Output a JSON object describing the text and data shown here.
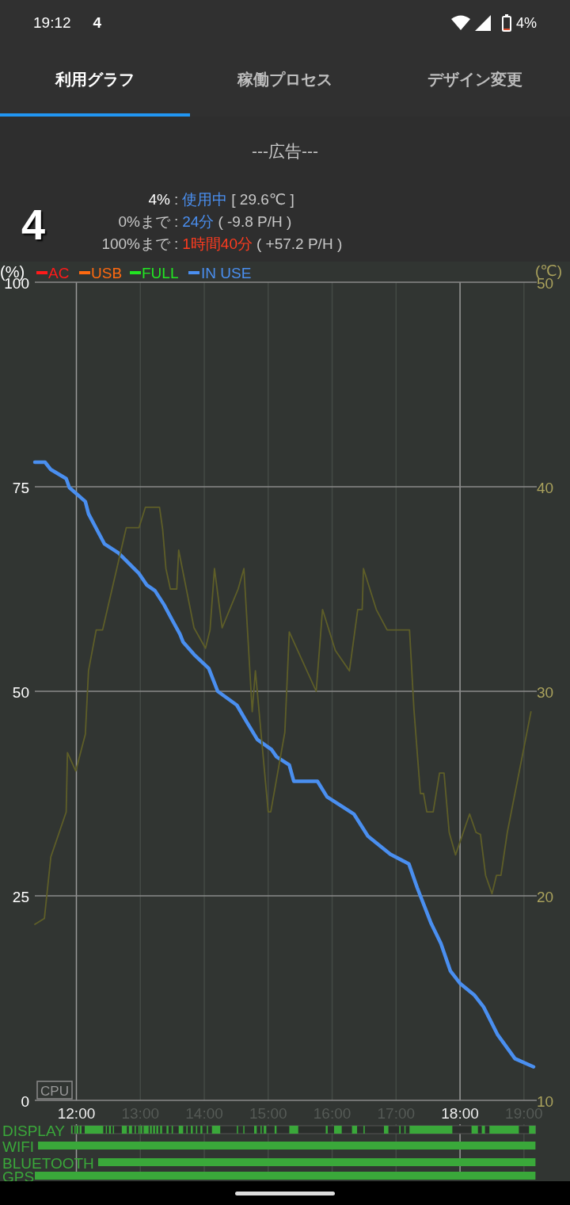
{
  "status_bar": {
    "time": "19:12",
    "notification": "4",
    "battery": "4%"
  },
  "tabs": [
    {
      "label": "利用グラフ",
      "selected": true
    },
    {
      "label": "稼働プロセス",
      "selected": false
    },
    {
      "label": "デザイン変更",
      "selected": false
    }
  ],
  "ad": "---広告---",
  "battery_level": "4",
  "info": [
    {
      "label": "4%",
      "sep": ":",
      "value": "使用中",
      "detail": "[ 29.6℃ ]",
      "color": "#4a8ff0"
    },
    {
      "label": "0%まで",
      "sep": ":",
      "value": "24分",
      "detail": "( -9.8 P/H )",
      "color": "#4a8ff0"
    },
    {
      "label": "100%まで",
      "sep": ":",
      "value": "1時間40分",
      "detail": "( +57.2 P/H )",
      "color": "#ff3b1f"
    }
  ],
  "legend": [
    {
      "label": "AC",
      "color": "#ff1a1a"
    },
    {
      "label": "USB",
      "color": "#ff6a10"
    },
    {
      "label": "FULL",
      "color": "#22e622"
    }
  ],
  "chart_data": {
    "type": "line",
    "grid": true,
    "ylabel": "(%)",
    "y2label": "(℃)",
    "xlim": [
      11.35,
      19.2
    ],
    "ylim": [
      0,
      100
    ],
    "y2lim": [
      10,
      50
    ],
    "yticks": [
      0,
      25,
      50,
      75,
      100
    ],
    "y2ticks": [
      10,
      20,
      30,
      40,
      50
    ],
    "xticks": [
      {
        "value": 12,
        "label": "12:00"
      },
      {
        "value": 13,
        "label": "13:00"
      },
      {
        "value": 14,
        "label": "14:00"
      },
      {
        "value": 15,
        "label": "15:00"
      },
      {
        "value": 16,
        "label": "16:00"
      },
      {
        "value": 17,
        "label": "17:00"
      },
      {
        "value": 18,
        "label": "18:00"
      },
      {
        "value": 19,
        "label": "19:00"
      }
    ],
    "series": [
      {
        "name": "IN USE",
        "color": "#4a8ff0",
        "x": [
          11.35,
          11.51,
          11.6,
          11.84,
          11.89,
          12.14,
          12.19,
          12.44,
          12.66,
          12.98,
          13.1,
          13.23,
          13.37,
          13.5,
          13.62,
          13.67,
          13.84,
          14.07,
          14.21,
          14.51,
          14.66,
          14.83,
          15.05,
          15.13,
          15.33,
          15.4,
          15.77,
          15.92,
          16.34,
          16.56,
          16.91,
          17.2,
          17.33,
          17.55,
          17.7,
          17.85,
          18.0,
          18.22,
          18.37,
          18.59,
          18.86,
          19.15
        ],
        "values": [
          78,
          78,
          77.1,
          76,
          74.9,
          73.2,
          71.7,
          68,
          66.9,
          64.4,
          63,
          62.3,
          60.6,
          58.7,
          57,
          56,
          54.5,
          52.8,
          50,
          48.3,
          46.3,
          44.1,
          42.9,
          42,
          41,
          39,
          39,
          37.1,
          35,
          32.3,
          30.1,
          28.9,
          26,
          21.6,
          19.2,
          15.8,
          14.3,
          12.9,
          11.4,
          8,
          5.1,
          4.1
        ]
      },
      {
        "color": "#5e5e28",
        "axis": "y2",
        "x": [
          11.35,
          11.5,
          11.6,
          11.84,
          11.86,
          11.99,
          12.14,
          12.19,
          12.31,
          12.41,
          12.78,
          12.98,
          13.08,
          13.3,
          13.35,
          13.4,
          13.47,
          13.57,
          13.6,
          13.84,
          14.02,
          14.09,
          14.16,
          14.28,
          14.53,
          14.62,
          14.75,
          14.8,
          15.0,
          15.04,
          15.26,
          15.33,
          15.75,
          15.85,
          16.05,
          16.27,
          16.4,
          16.47,
          16.49,
          16.69,
          16.86,
          17.21,
          17.28,
          17.38,
          17.43,
          17.48,
          17.58,
          17.68,
          17.75,
          17.83,
          17.93,
          18.15,
          18.25,
          18.32,
          18.4,
          18.5,
          18.57,
          18.64,
          18.74,
          19.11
        ],
        "values": [
          18.6,
          18.9,
          21.9,
          24.1,
          27,
          26.1,
          27.9,
          31,
          33,
          33,
          38,
          38,
          39,
          39,
          37.9,
          36,
          35,
          35,
          36.9,
          33.1,
          32.1,
          33,
          36,
          33.1,
          35,
          36,
          29,
          31,
          24.1,
          24.1,
          28,
          32.9,
          30,
          34,
          32,
          31,
          34,
          34,
          36,
          34,
          33,
          33,
          29.1,
          25,
          25,
          24.1,
          24.1,
          26,
          26,
          23.1,
          22,
          24,
          23.1,
          23,
          21,
          20.1,
          21,
          21,
          23.1,
          29
        ]
      }
    ]
  },
  "cpu_label": "CPU",
  "activity": [
    {
      "label": "DISPLAY"
    },
    {
      "label": "WIFI"
    },
    {
      "label": "BLUETOOTH"
    },
    {
      "label": "GPS"
    }
  ]
}
